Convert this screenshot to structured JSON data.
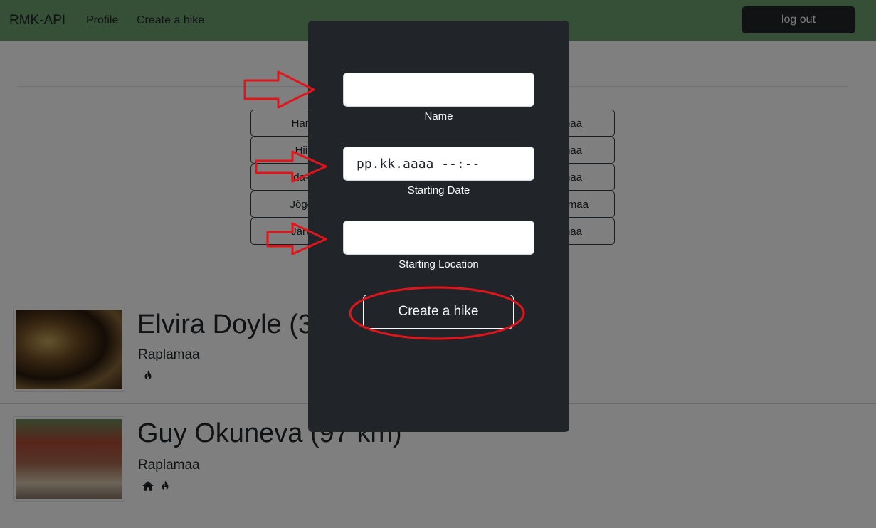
{
  "navbar": {
    "brand": "RMK-API",
    "links": [
      "Profile",
      "Create a hike"
    ],
    "logout_label": "log out"
  },
  "counties_left": [
    "Harju",
    "Hiiu",
    "Ida-Vi",
    "Jõgev",
    "Järva"
  ],
  "counties_right": [
    "maa",
    "maa",
    "maa",
    "amaa",
    "maa"
  ],
  "hikes": [
    {
      "title": "Elvira Doyle (3",
      "location": "Raplamaa",
      "icons": [
        "fire-icon"
      ]
    },
    {
      "title": "Guy Okuneva (97 km)",
      "location": "Raplamaa",
      "icons": [
        "house-icon",
        "fire-icon"
      ]
    }
  ],
  "modal": {
    "name_value": "",
    "name_label": "Name",
    "date_value": "pp.kk.aaaa --:--",
    "date_label": "Starting Date",
    "location_value": "",
    "location_label": "Starting Location",
    "submit_label": "Create a hike"
  },
  "colors": {
    "navbar": "#6ba06e",
    "modal_bg": "#212529",
    "annotation": "#e0151b"
  }
}
